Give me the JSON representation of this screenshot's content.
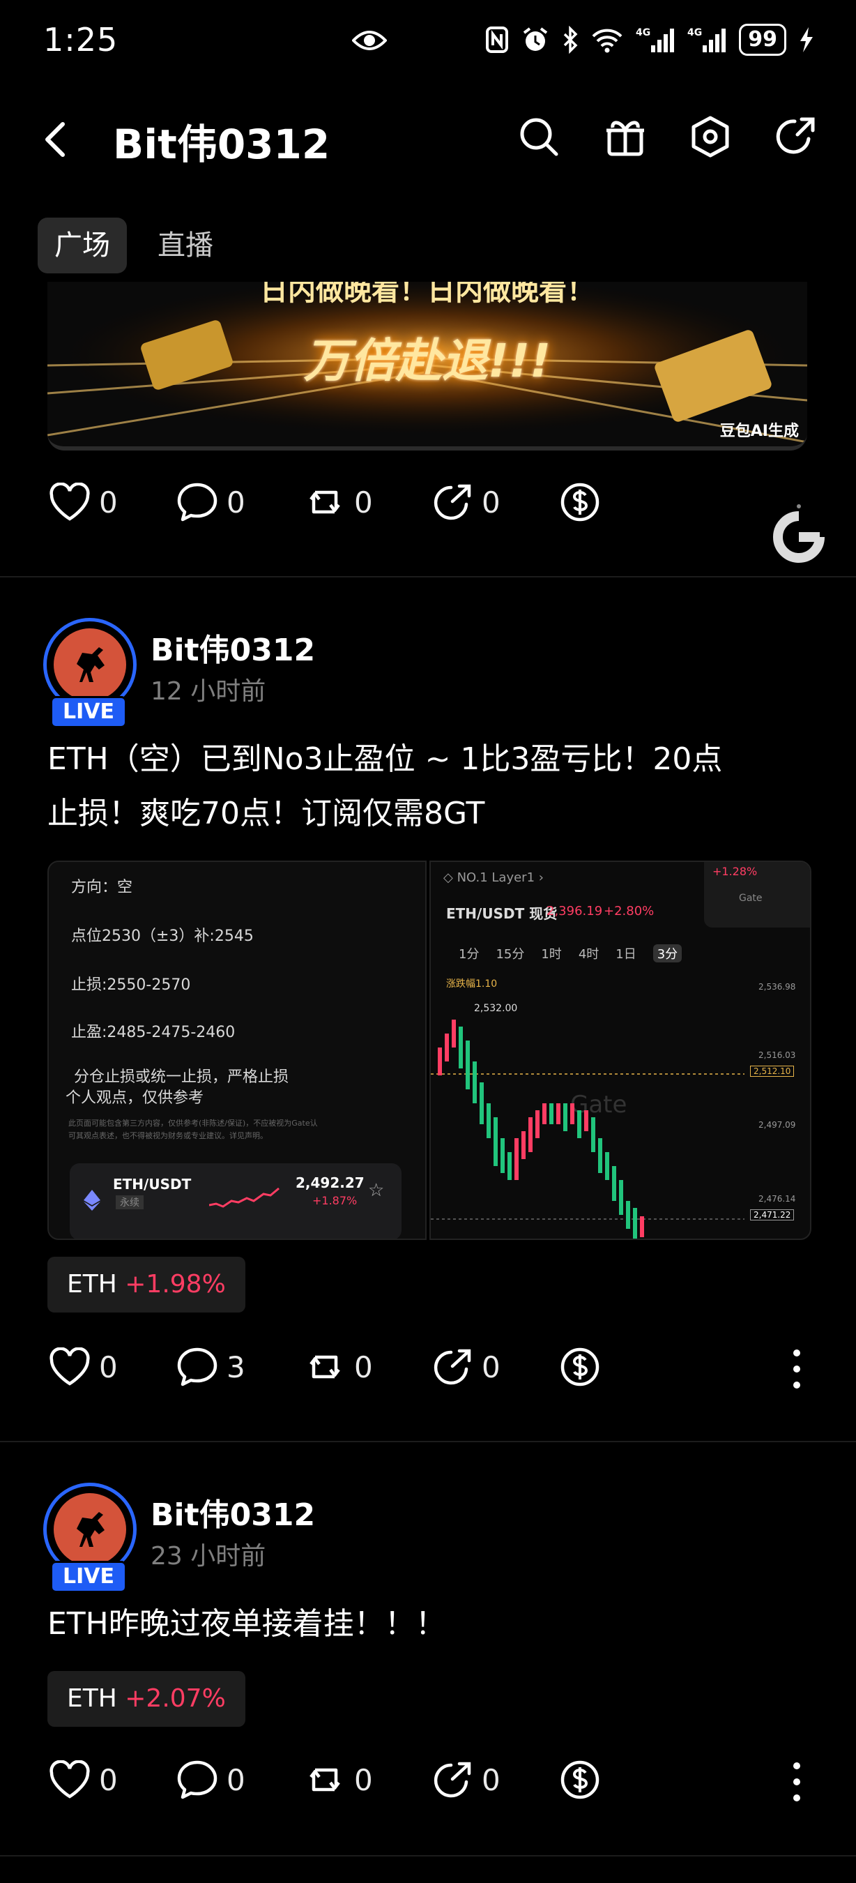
{
  "status": {
    "time": "1:25",
    "battery": "99"
  },
  "header": {
    "title": "Bit伟0312"
  },
  "tabs": [
    {
      "label": "广场"
    },
    {
      "label": "直播"
    }
  ],
  "banner": {
    "top_text": "日内做晚看！日内做晚看！",
    "main_text": "万倍赴退!!!",
    "tag": "豆包AI生成"
  },
  "post0": {
    "likes": "0",
    "comments": "0",
    "reposts": "0",
    "shares": "0"
  },
  "post1": {
    "author": "Bit伟0312",
    "live": "LIVE",
    "time": "12 小时前",
    "text_line1": "ETH（空）已到No3止盈位 ~ 1比3盈亏比！20点",
    "text_line2": "止损！爽吃70点！订阅仅需8GT",
    "image_left": {
      "direction": "方向：空",
      "entry": "点位2530（±3）补:2545",
      "stop": "止损:2550-2570",
      "take": "止盈:2485-2475-2460",
      "note1": "分仓止损或统一止损，严格止损",
      "note2": "个人观点，仅供参考",
      "disclaimer1": "此页面可能包含第三方内容，仅供参考(非陈述/保证)，不应被视为Gate认",
      "disclaimer2": "可其观点表述，也不得被视为财务或专业建议。详见声明。",
      "pair": "ETH/USDT",
      "pair_sub": "永续",
      "price": "2,492.27",
      "change": "+1.87%"
    },
    "image_right": {
      "breadcrumb1": "NO.1",
      "breadcrumb2": "Layer1",
      "pair": "ETH/USDT 现货",
      "price": "2,396.19",
      "change": "+2.80%",
      "corner1": "+1.28%",
      "corner2": "Gate",
      "intervals": [
        "1分",
        "15分",
        "1时",
        "4时",
        "1日",
        "3分"
      ],
      "indicator": "涨跌幅1.10",
      "high_label": "2,532.00",
      "axis": [
        "2,536.98",
        "2,516.03",
        "2,512.10",
        "2,497.09",
        "2,476.14",
        "2,471.22"
      ],
      "watermark": "Gate"
    },
    "chip": {
      "coin": "ETH",
      "pct": "+1.98%"
    },
    "likes": "0",
    "comments": "3",
    "reposts": "0",
    "shares": "0"
  },
  "post2": {
    "author": "Bit伟0312",
    "live": "LIVE",
    "time": "23 小时前",
    "text": "ETH昨晚过夜单接着挂！！！",
    "chip": {
      "coin": "ETH",
      "pct": "+2.07%"
    },
    "likes": "0",
    "comments": "0",
    "reposts": "0",
    "shares": "0"
  },
  "colors": {
    "accent_red": "#ff3d63",
    "live_blue": "#1e5cf5",
    "chip_bg": "#1d1d1d"
  }
}
